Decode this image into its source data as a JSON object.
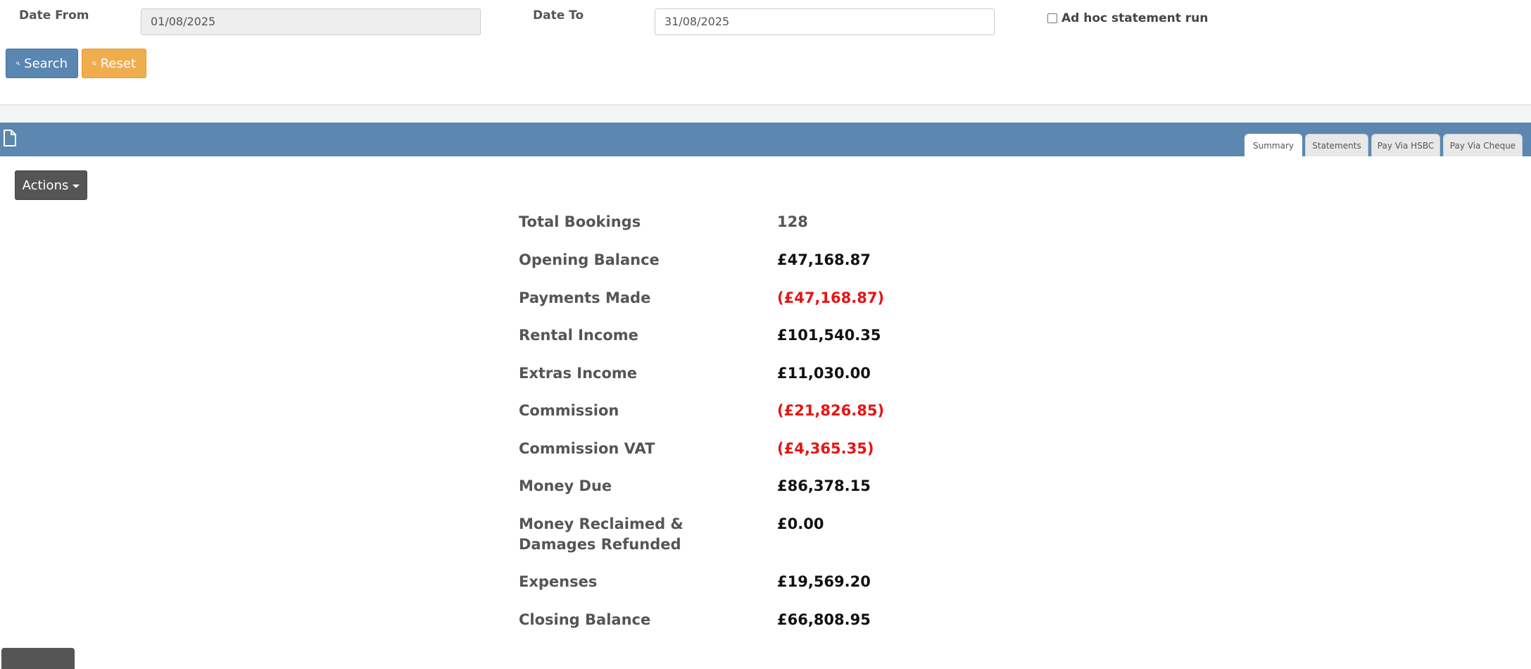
{
  "filters": {
    "date_from_label": "Date From",
    "date_from_value": "01/08/2025",
    "date_to_label": "Date To",
    "date_to_value": "31/08/2025",
    "adhoc_label": "Ad hoc statement run",
    "adhoc_checked": false
  },
  "buttons": {
    "search": "Search",
    "reset": "Reset",
    "actions": "Actions"
  },
  "tabs": [
    {
      "label": "Summary",
      "active": true
    },
    {
      "label": "Statements",
      "active": false
    },
    {
      "label": "Pay Via HSBC",
      "active": false
    },
    {
      "label": "Pay Via Cheque",
      "active": false
    }
  ],
  "summary": [
    {
      "label": "Total Bookings",
      "value": "128"
    },
    {
      "label": "Opening Balance",
      "value": "£47,168.87"
    },
    {
      "label": "Payments Made",
      "value": "(£47,168.87)"
    },
    {
      "label": "Rental Income",
      "value": "£101,540.35"
    },
    {
      "label": "Extras Income",
      "value": "£11,030.00"
    },
    {
      "label": "Commission",
      "value": "(£21,826.85)"
    },
    {
      "label": "Commission VAT",
      "value": "(£4,365.35)"
    },
    {
      "label": "Money Due",
      "value": "£86,378.15"
    },
    {
      "label": "Money Reclaimed & Damages Refunded",
      "value": "£0.00"
    },
    {
      "label": "Expenses",
      "value": "£19,569.20"
    },
    {
      "label": "Closing Balance",
      "value": "£66,808.95"
    }
  ],
  "colors": {
    "header_blue": "#5b87b0",
    "search_blue": "#5a86b2",
    "reset_orange": "#f0ad4e",
    "negative_red": "#e81313"
  }
}
